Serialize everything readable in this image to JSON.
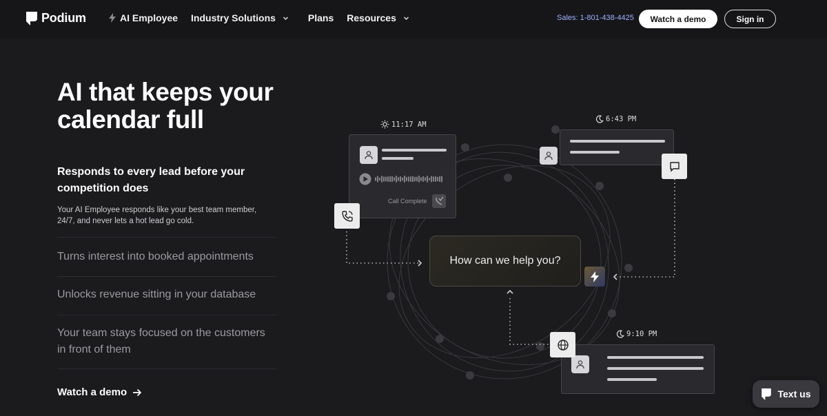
{
  "nav": {
    "brand": "Podium",
    "links": [
      {
        "label": "AI Employee"
      },
      {
        "label": "Industry Solutions"
      },
      {
        "label": "Plans"
      },
      {
        "label": "Resources"
      }
    ],
    "sales": "Sales: 1-801-438-4425",
    "demo_label": "Watch a demo",
    "signin_label": "Sign in"
  },
  "hero": {
    "title": "AI that keeps your calendar full",
    "subhead": "Responds to every lead before your competition does",
    "subbody": "Your AI Employee responds like your best team member, 24/7, and never lets a hot lead go cold.",
    "features": [
      "Turns interest into booked appointments",
      "Unlocks revenue sitting in your database",
      "Your team stays focused on the customers in front of them"
    ],
    "cta": "Watch a demo"
  },
  "illustration": {
    "times": [
      "11:17 AM",
      "6:43 PM",
      "9:10 PM"
    ],
    "call_status": "Call Complete",
    "prompt": "How can we help you?"
  },
  "chat_widget": {
    "label": "Text us"
  },
  "colors": {
    "accent_link": "#9db3ff",
    "background": "#1b1a1d"
  }
}
